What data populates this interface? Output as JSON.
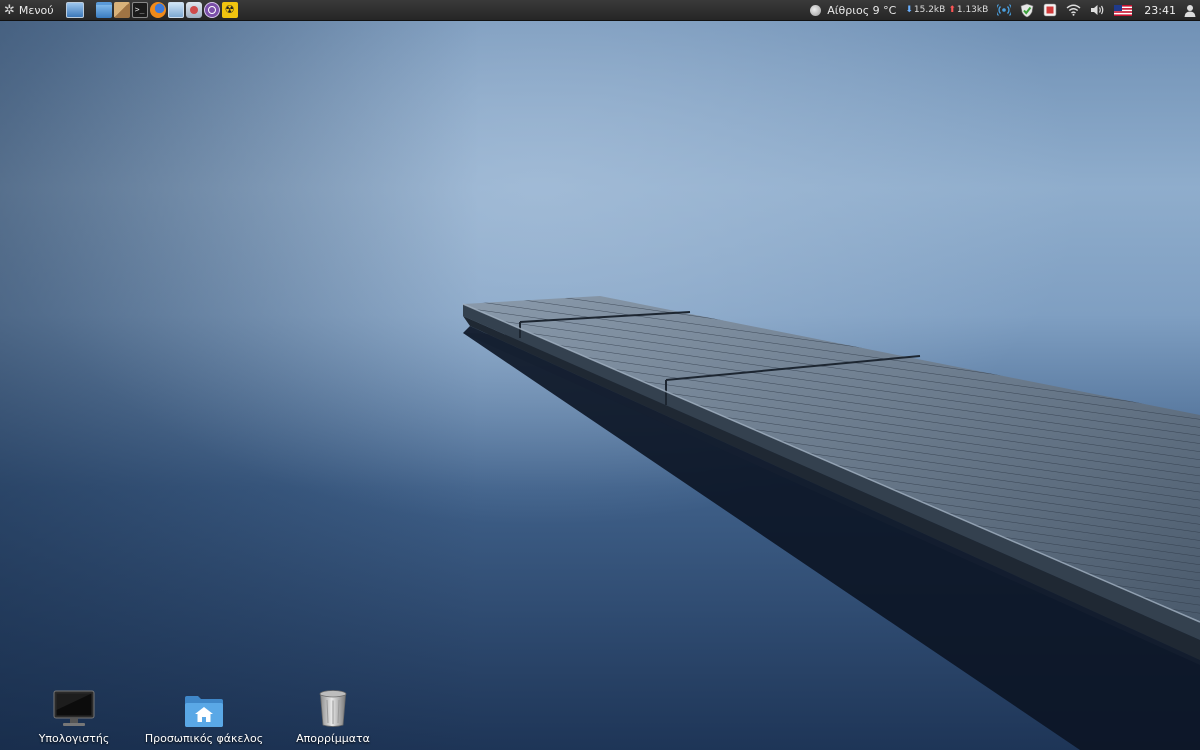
{
  "panel": {
    "menu_label": "Μενού",
    "launchers": [
      "show-desktop-icon",
      "file-manager-icon",
      "archive-manager-icon",
      "terminal-icon",
      "firefox-icon",
      "text-editor-icon",
      "screenshot-icon",
      "viber-icon",
      "radiation-app-icon"
    ],
    "weather": "Αίθριος 9 °C",
    "net_down": "15.2kB",
    "net_up": "1.13kB",
    "clock": "23:41"
  },
  "desktop": {
    "icons": [
      {
        "label": "Υπολογιστής"
      },
      {
        "label": "Προσωπικός φάκελος"
      },
      {
        "label": "Απορρίμματα"
      }
    ]
  },
  "colors": {
    "panel_bg": "#2e2e2e",
    "sky_light": "#98b3cf",
    "water_dark": "#1f3554",
    "dock_wood": "#5c6e82"
  }
}
